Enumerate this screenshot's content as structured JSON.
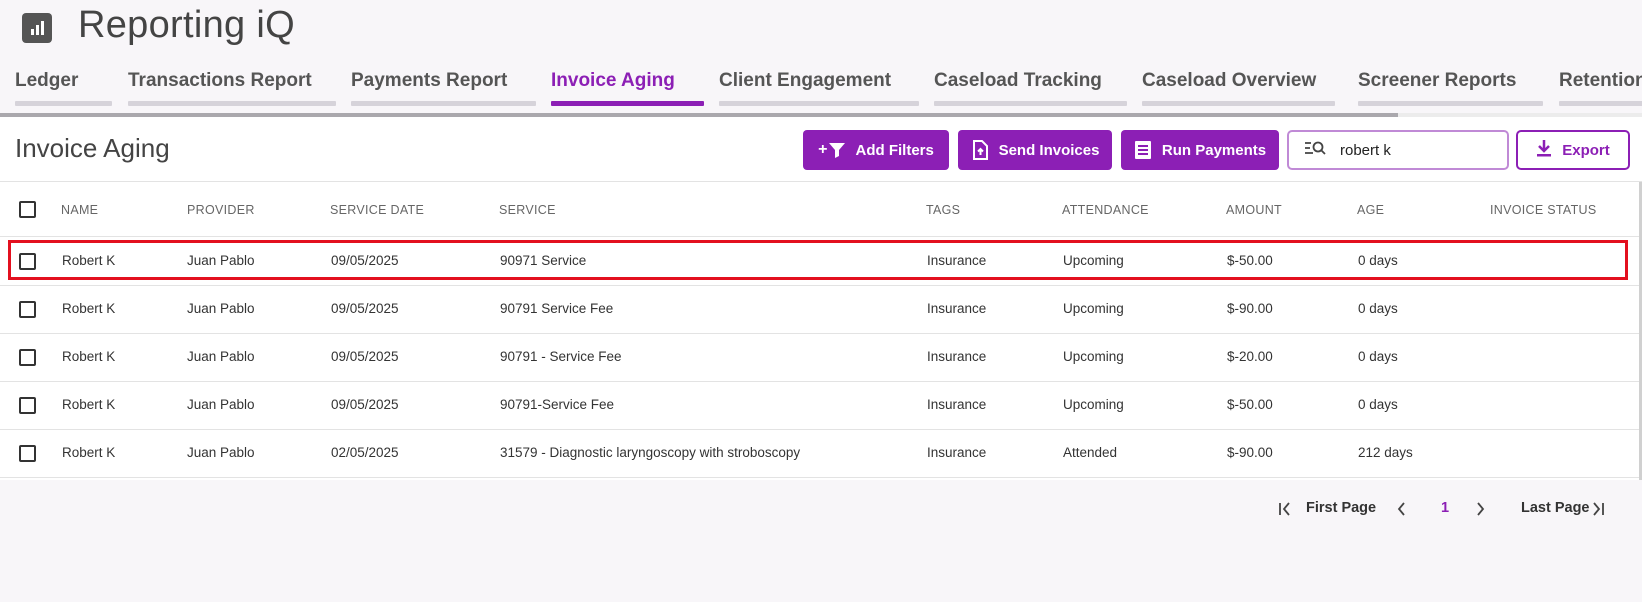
{
  "app": {
    "title": "Reporting iQ",
    "logo_icon": "bar-chart-icon"
  },
  "tabs": [
    {
      "label": "Ledger",
      "active": false
    },
    {
      "label": "Transactions Report",
      "active": false
    },
    {
      "label": "Payments Report",
      "active": false
    },
    {
      "label": "Invoice Aging",
      "active": true
    },
    {
      "label": "Client Engagement",
      "active": false
    },
    {
      "label": "Caseload Tracking",
      "active": false
    },
    {
      "label": "Caseload Overview",
      "active": false
    },
    {
      "label": "Screener Reports",
      "active": false
    },
    {
      "label": "Retention",
      "active": false
    }
  ],
  "page": {
    "title": "Invoice Aging"
  },
  "toolbar": {
    "add_filters": "Add Filters",
    "add_filters_prefix": "+",
    "send_invoices": "Send Invoices",
    "run_payments": "Run Payments",
    "search_value": "robert k",
    "export": "Export"
  },
  "table": {
    "headers": [
      "NAME",
      "PROVIDER",
      "SERVICE DATE",
      "SERVICE",
      "TAGS",
      "ATTENDANCE",
      "AMOUNT",
      "AGE",
      "INVOICE STATUS"
    ],
    "rows": [
      {
        "name": "Robert K",
        "provider": "Juan Pablo",
        "date": "09/05/2025",
        "service": "90971 Service",
        "tags": "Insurance",
        "attendance": "Upcoming",
        "amount": "$-50.00",
        "age": "0 days",
        "status": "",
        "highlighted": true
      },
      {
        "name": "Robert K",
        "provider": "Juan Pablo",
        "date": "09/05/2025",
        "service": "90791 Service Fee",
        "tags": "Insurance",
        "attendance": "Upcoming",
        "amount": "$-90.00",
        "age": "0 days",
        "status": ""
      },
      {
        "name": "Robert K",
        "provider": "Juan Pablo",
        "date": "09/05/2025",
        "service": "90791 - Service Fee",
        "tags": "Insurance",
        "attendance": "Upcoming",
        "amount": "$-20.00",
        "age": "0 days",
        "status": ""
      },
      {
        "name": "Robert K",
        "provider": "Juan Pablo",
        "date": "09/05/2025",
        "service": "90791-Service Fee",
        "tags": "Insurance",
        "attendance": "Upcoming",
        "amount": "$-50.00",
        "age": "0 days",
        "status": ""
      },
      {
        "name": "Robert K",
        "provider": "Juan Pablo",
        "date": "02/05/2025",
        "service": "31579 - Diagnostic laryngoscopy with stroboscopy",
        "tags": "Insurance",
        "attendance": "Attended",
        "amount": "$-90.00",
        "age": "212 days",
        "status": ""
      }
    ]
  },
  "pagination": {
    "first": "First Page",
    "current": "1",
    "last": "Last Page"
  },
  "colors": {
    "accent": "#8c1fb5",
    "highlight": "#e3101f"
  }
}
